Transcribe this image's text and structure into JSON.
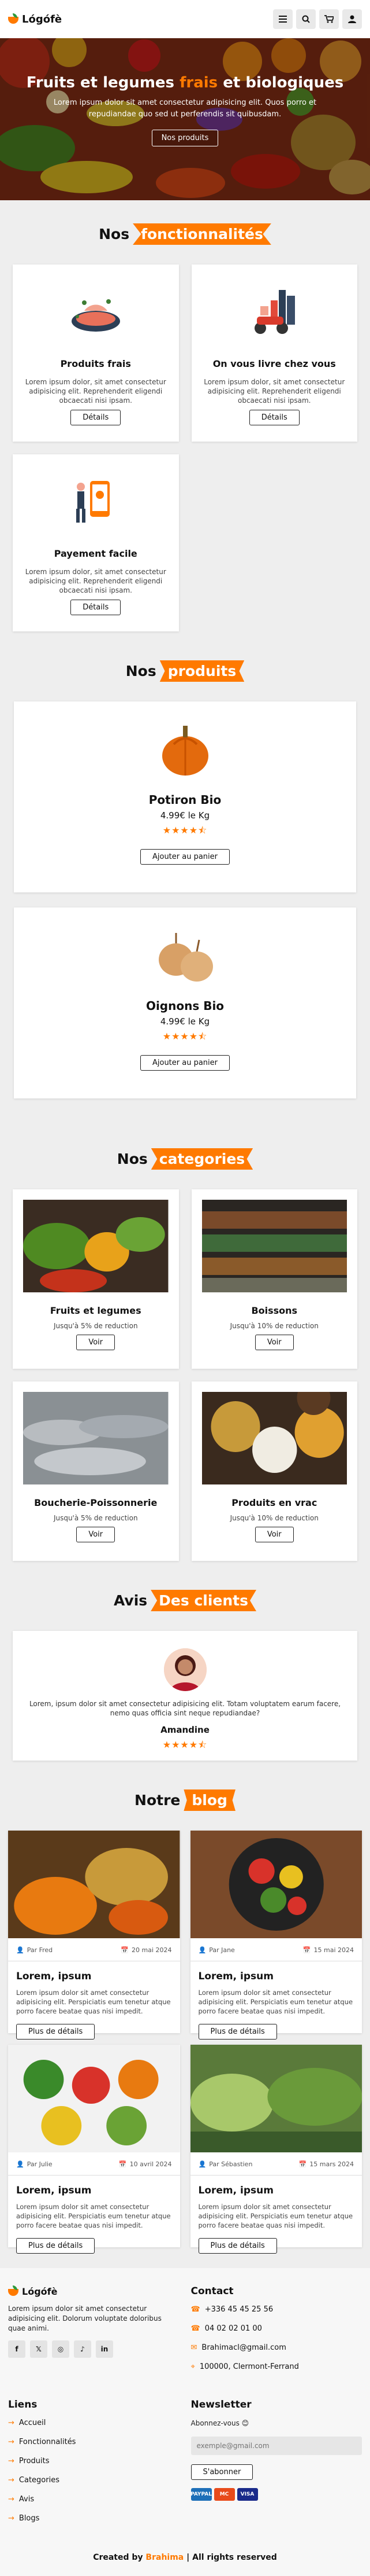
{
  "header": {
    "brand": "Lógófè",
    "icons": [
      "menu-icon",
      "search-icon",
      "cart-icon",
      "user-icon"
    ]
  },
  "hero": {
    "title_a": "Fruits et legumes",
    "title_b": "frais",
    "title_c": "et biologiques",
    "text": "Lorem ipsum dolor sit amet consectetur adipisicing elit. Quos porro et repudiandae quo sed ut perferendis sit quibusdam.",
    "button": "Nos produits"
  },
  "features": {
    "title_a": "Nos",
    "title_b": "fonctionnalités",
    "items": [
      {
        "title": "Produits frais",
        "desc": "Lorem ipsum dolor, sit amet consectetur adipisicing elit. Reprehenderit eligendi obcaecati nisi ipsam.",
        "button": "Détails"
      },
      {
        "title": "On vous livre chez vous",
        "desc": "Lorem ipsum dolor, sit amet consectetur adipisicing elit. Reprehenderit eligendi obcaecati nisi ipsam.",
        "button": "Détails"
      },
      {
        "title": "Payement facile",
        "desc": "Lorem ipsum dolor, sit amet consectetur adipisicing elit. Reprehenderit eligendi obcaecati nisi ipsam.",
        "button": "Détails"
      }
    ]
  },
  "products": {
    "title_a": "Nos",
    "title_b": "produits",
    "items": [
      {
        "name": "Potiron Bio",
        "price": "4.99€ le Kg",
        "rating": 4.5,
        "stars": "★★★★⯪",
        "button": "Ajouter au panier"
      },
      {
        "name": "Oignons Bio",
        "price": "4.99€ le Kg",
        "rating": 4.5,
        "stars": "★★★★⯪",
        "button": "Ajouter au panier"
      }
    ]
  },
  "categories": {
    "title_a": "Nos",
    "title_b": "categories",
    "items": [
      {
        "name": "Fruits et legumes",
        "sub": "Jusqu'à 5% de reduction",
        "button": "Voir"
      },
      {
        "name": "Boissons",
        "sub": "Jusqu'à 10% de reduction",
        "button": "Voir"
      },
      {
        "name": "Boucherie-Poissonnerie",
        "sub": "Jusqu'à 5% de reduction",
        "button": "Voir"
      },
      {
        "name": "Produits en vrac",
        "sub": "Jusqu'à 10% de reduction",
        "button": "Voir"
      }
    ]
  },
  "reviews": {
    "title_a": "Avis",
    "title_b": "Des clients",
    "items": [
      {
        "text": "Lorem, ipsum dolor sit amet consectetur adipisicing elit. Totam voluptatem earum facere, nemo quas officia sint neque repudiandae?",
        "name": "Amandine",
        "rating": 4.5,
        "stars": "★★★★⯪"
      }
    ]
  },
  "blog": {
    "title_a": "Notre",
    "title_b": "blog",
    "items": [
      {
        "author": "Par Fred",
        "date": "20 mai 2024",
        "title": "Lorem, ipsum",
        "text": "Lorem ipsum dolor sit amet consectetur adipisicing elit. Perspiciatis eum tenetur atque porro facere beatae quas nisi impedit.",
        "button": "Plus de détails"
      },
      {
        "author": "Par Jane",
        "date": "15 mai 2024",
        "title": "Lorem, ipsum",
        "text": "Lorem ipsum dolor sit amet consectetur adipisicing elit. Perspiciatis eum tenetur atque porro facere beatae quas nisi impedit.",
        "button": "Plus de détails"
      },
      {
        "author": "Par Julie",
        "date": "10 avril 2024",
        "title": "Lorem, ipsum",
        "text": "Lorem ipsum dolor sit amet consectetur adipisicing elit. Perspiciatis eum tenetur atque porro facere beatae quas nisi impedit.",
        "button": "Plus de détails"
      },
      {
        "author": "Par Sébastien",
        "date": "15 mars 2024",
        "title": "Lorem, ipsum",
        "text": "Lorem ipsum dolor sit amet consectetur adipisicing elit. Perspiciatis eum tenetur atque porro facere beatae quas nisi impedit.",
        "button": "Plus de détails"
      }
    ]
  },
  "footer": {
    "brand": "Lógófè",
    "about": "Lorem ipsum dolor sit amet consectetur adipisicing elit. Dolorum voluptate doloribus quae animi.",
    "social": [
      "facebook-icon",
      "twitter-icon",
      "instagram-icon",
      "tiktok-icon",
      "linkedin-icon"
    ],
    "contact": {
      "title": "Contact",
      "phone1": "+336 45 45 25 56",
      "phone2": "04 02 02 01 00",
      "email": "Brahimacl@gmail.com",
      "address": "100000, Clermont-Ferrand"
    },
    "links": {
      "title": "Liens",
      "items": [
        "Accueil",
        "Fonctionnalités",
        "Produits",
        "Categories",
        "Avis",
        "Blogs"
      ]
    },
    "newsletter": {
      "title": "Newsletter",
      "label": "Abonnez-vous 😊",
      "placeholder": "exemple@gmail.com",
      "button": "S'abonner",
      "payments": [
        "PAYPAL",
        "MC",
        "VISA"
      ]
    },
    "credits_a": "Created by",
    "credits_b": "Brahima",
    "credits_c": "| All rights reserved"
  },
  "colors": {
    "accent": "#ff7a00"
  }
}
